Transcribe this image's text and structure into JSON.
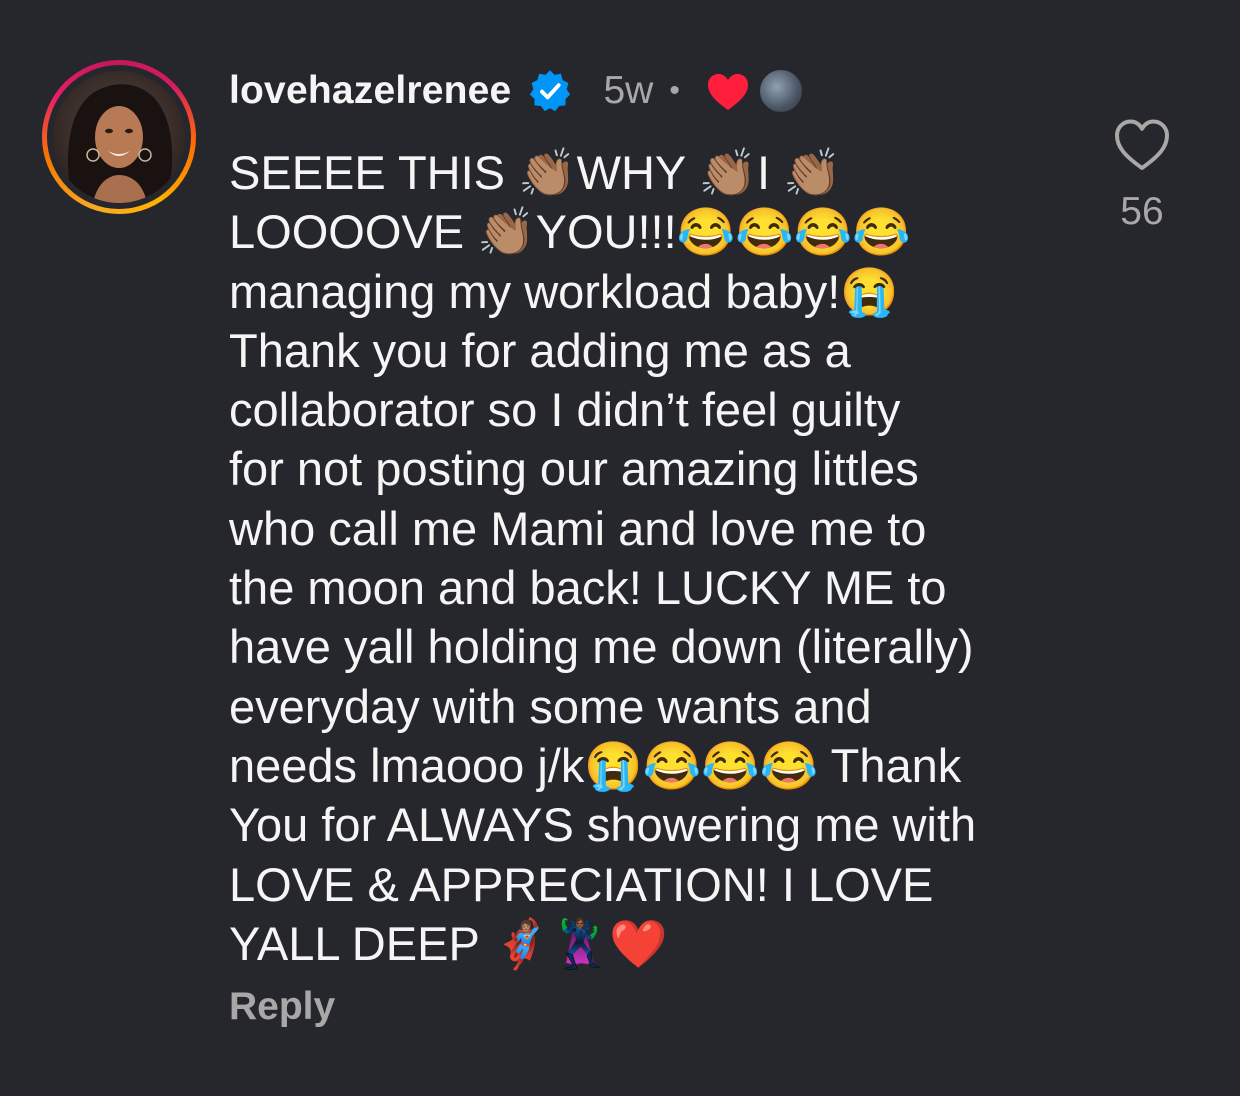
{
  "comment": {
    "username": "lovehazelrenee",
    "time_ago": "5w",
    "separator": "•",
    "like_count": "56",
    "reply_label": "Reply",
    "lines": [
      "SEEEE THIS 👏🏽WHY 👏🏽I 👏🏽",
      "LOOOOVE 👏🏽YOU!!!😂😂😂😂",
      "managing my workload baby!😭",
      "Thank you for adding me as a",
      "collaborator so I didn’t feel guilty",
      "for not posting our amazing littles",
      "who call me Mami and love me to",
      "the moon and back! LUCKY ME to",
      "have yall holding me down (literally)",
      "everyday with some wants and",
      "needs lmaooo j/k😭😂😂😂 Thank",
      "You for ALWAYS showering me with",
      "LOVE & APPRECIATION! I LOVE",
      "YALL DEEP 🦸🏽‍♀️🦹🏾‍♀️❤️"
    ]
  },
  "icons": {
    "verified": "verified-badge-icon",
    "creator_heart": "heart-icon",
    "like": "heart-outline-icon"
  },
  "colors": {
    "background": "#26272c",
    "text": "#f5f5f5",
    "secondary_text": "#a8a8a8",
    "verified_blue": "#0095f6",
    "heart_red": "#ff1f3d"
  }
}
